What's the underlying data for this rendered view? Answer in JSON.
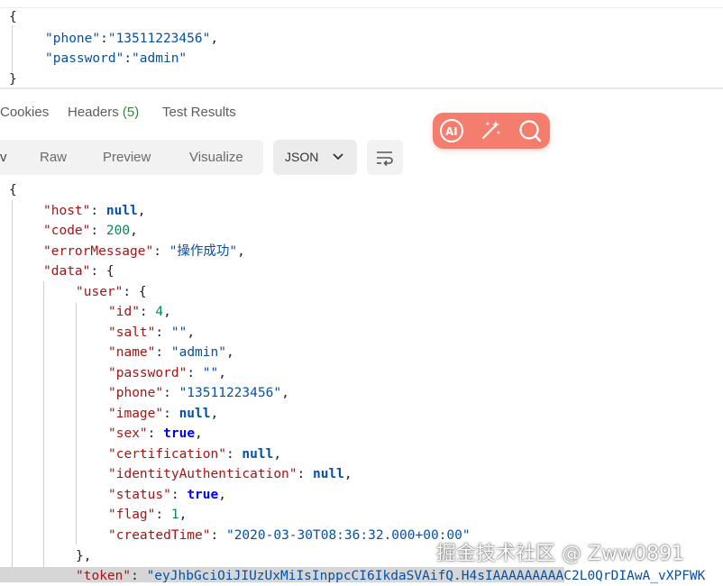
{
  "request_body": {
    "open": "{",
    "lines": [
      {
        "key": "\"phone\"",
        "sep": ":",
        "value": "\"13511223456\"",
        "trail": ","
      },
      {
        "key": "\"password\"",
        "sep": ":",
        "value": "\"admin\"",
        "trail": ""
      }
    ],
    "close": "}"
  },
  "response_tabs": [
    {
      "label": "Cookies"
    },
    {
      "label": "Headers",
      "count": "(5)"
    },
    {
      "label": "Test Results"
    }
  ],
  "view_tabs": {
    "cut": "v",
    "items": [
      "Raw",
      "Preview",
      "Visualize"
    ]
  },
  "format_select": {
    "value": "JSON"
  },
  "response_json": {
    "open": "{",
    "host": {
      "key": "\"host\"",
      "value": "null"
    },
    "code": {
      "key": "\"code\"",
      "value": "200"
    },
    "errorMessage": {
      "key": "\"errorMessage\"",
      "value": "\"操作成功\""
    },
    "data_key": "\"data\"",
    "user_key": "\"user\"",
    "user": [
      {
        "key": "\"id\"",
        "value": "4",
        "type": "n",
        "trail": ","
      },
      {
        "key": "\"salt\"",
        "value": "\"\"",
        "type": "s",
        "trail": ","
      },
      {
        "key": "\"name\"",
        "value": "\"admin\"",
        "type": "s",
        "trail": ","
      },
      {
        "key": "\"password\"",
        "value": "\"\"",
        "type": "s",
        "trail": ","
      },
      {
        "key": "\"phone\"",
        "value": "\"13511223456\"",
        "type": "s",
        "trail": ","
      },
      {
        "key": "\"image\"",
        "value": "null",
        "type": "nl",
        "trail": ","
      },
      {
        "key": "\"sex\"",
        "value": "true",
        "type": "kw",
        "trail": ","
      },
      {
        "key": "\"certification\"",
        "value": "null",
        "type": "nl",
        "trail": ","
      },
      {
        "key": "\"identityAuthentication\"",
        "value": "null",
        "type": "nl",
        "trail": ","
      },
      {
        "key": "\"status\"",
        "value": "true",
        "type": "kw",
        "trail": ","
      },
      {
        "key": "\"flag\"",
        "value": "1",
        "type": "n",
        "trail": ","
      },
      {
        "key": "\"createdTime\"",
        "value": "\"2020-03-30T08:36:32.000+00:00\"",
        "type": "s",
        "trail": ""
      }
    ],
    "user_close": "},",
    "token": {
      "key": "\"token\"",
      "value": "\"eyJhbGciOiJIUzUxMiIsInppcCI6IkdaSVAifQ.H4sIAAAAAAAAAC2L0QrDIAwA_vXPFWK"
    }
  },
  "watermark": "掘金技术社区 @ Zww0891",
  "colors": {
    "ai_pill": "#f47d6e",
    "headers_count": "#2c8a3c"
  }
}
